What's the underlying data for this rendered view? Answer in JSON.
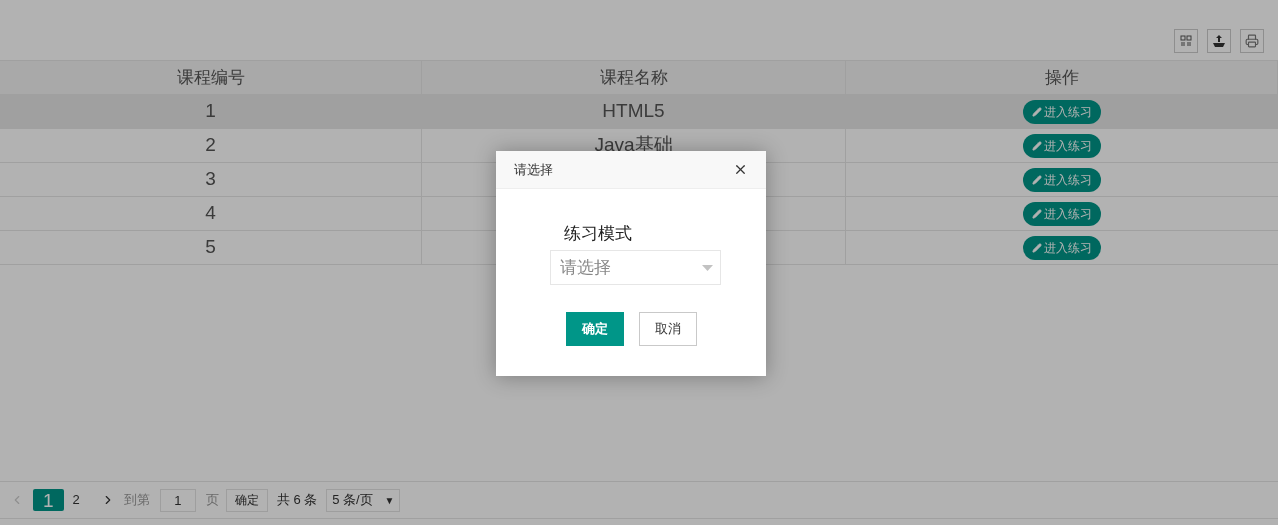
{
  "table": {
    "columns": [
      "课程编号",
      "课程名称",
      "操作"
    ],
    "rows": [
      {
        "id": "1",
        "name": "HTML5",
        "action": "进入练习",
        "highlighted": true
      },
      {
        "id": "2",
        "name": "Java基础",
        "action": "进入练习",
        "highlighted": false
      },
      {
        "id": "3",
        "action": "进入练习",
        "highlighted": false
      },
      {
        "id": "4",
        "action": "进入练习",
        "highlighted": false
      },
      {
        "id": "5",
        "action": "进入练习",
        "highlighted": false
      }
    ]
  },
  "pagination": {
    "pages": [
      {
        "label": "1",
        "selected": true
      },
      {
        "label": "2",
        "selected": false
      }
    ],
    "goto_label": "到第",
    "goto_value": "1",
    "page_unit": "页",
    "confirm": "确定",
    "total": "共 6 条",
    "page_size": "5 条/页",
    "page_size_caret": "▼"
  },
  "dialog": {
    "title": "请选择",
    "field_label": "练习模式",
    "select_placeholder": "请选择",
    "buttons": [
      {
        "label": "确定",
        "kind": "primary"
      },
      {
        "label": "取消",
        "kind": "secondary"
      }
    ]
  }
}
